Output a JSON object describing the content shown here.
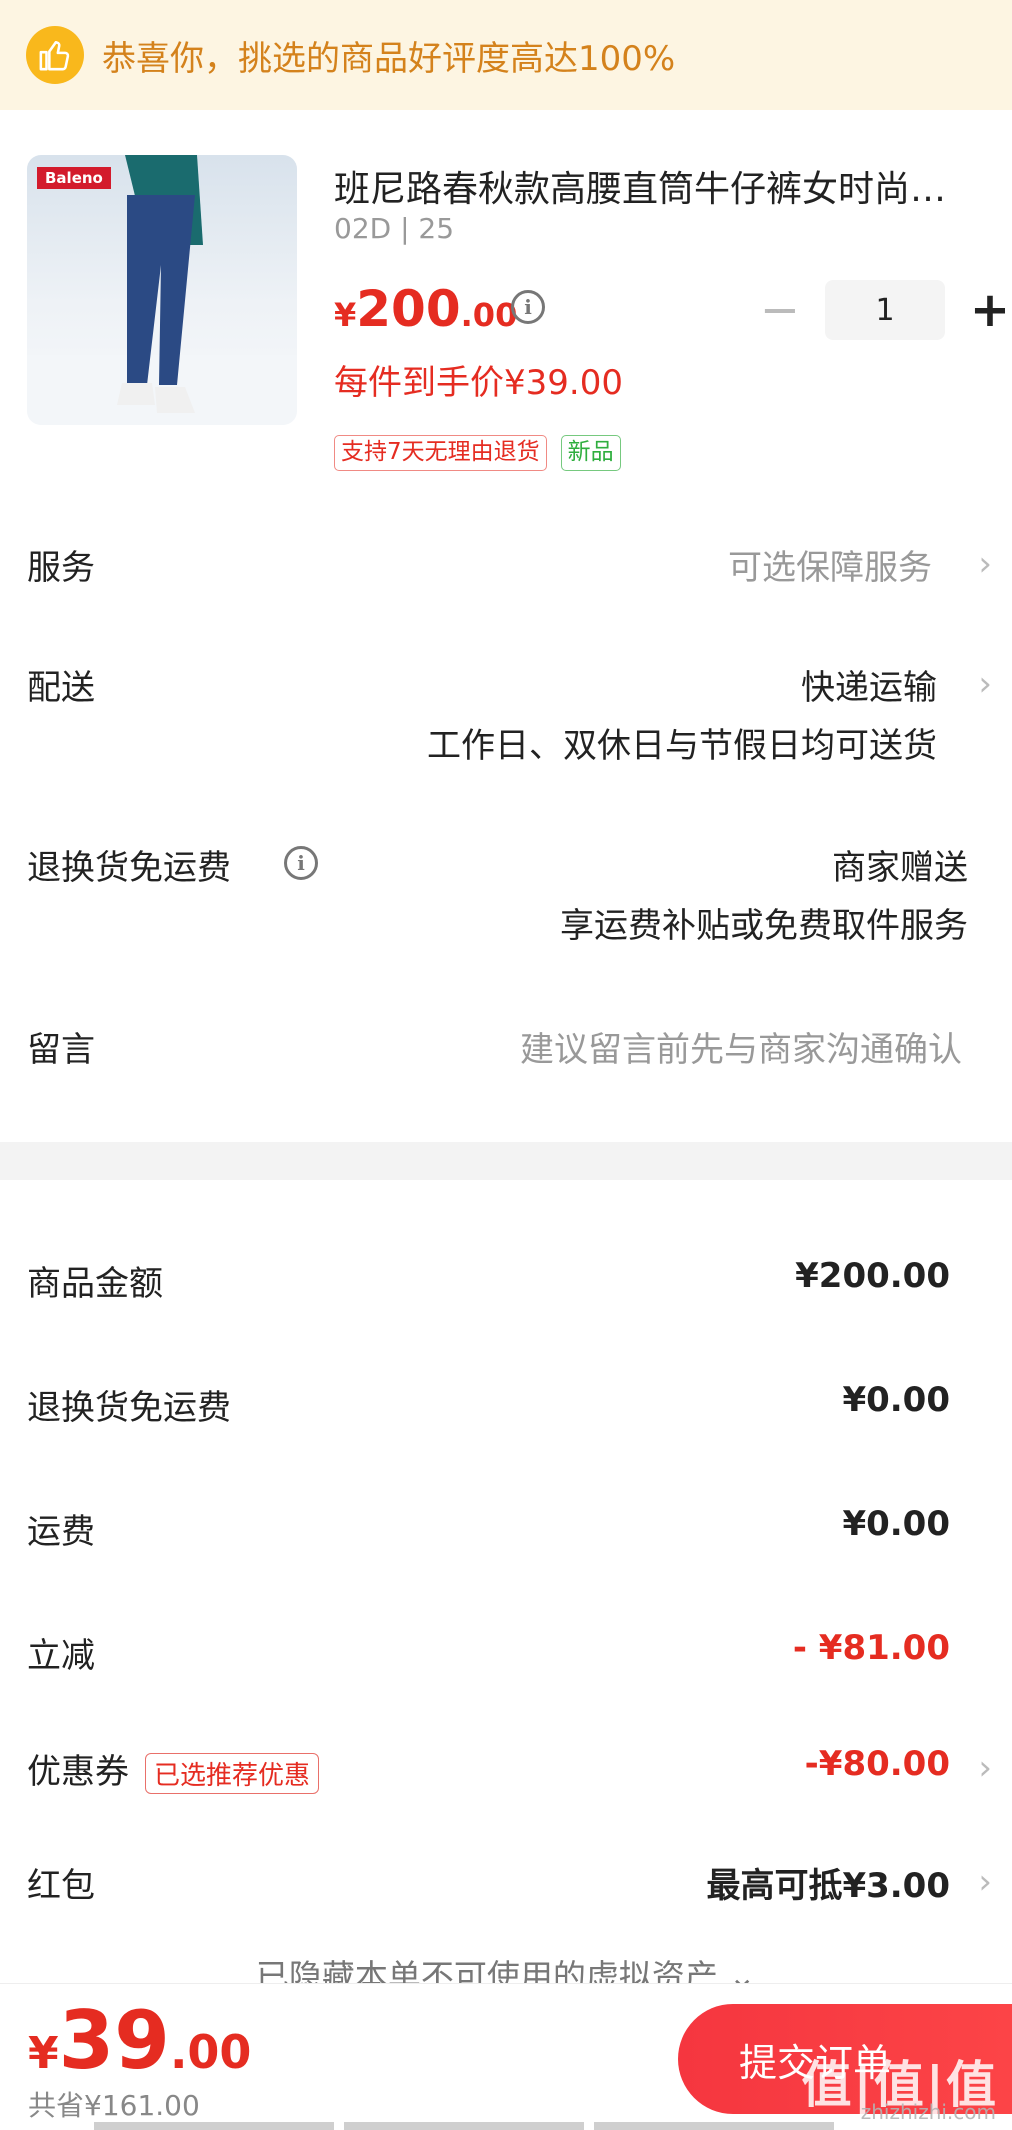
{
  "banner": {
    "text": "恭喜你，挑选的商品好评度高达100%",
    "icon": "thumbs-up-icon"
  },
  "product": {
    "brand_label": "Baleno",
    "title": "班尼路春秋款高腰直筒牛仔裤女时尚…",
    "sku": "02D | 25",
    "price_symbol": "¥",
    "price_int": "200",
    "price_dec": ".00",
    "final_price": "每件到手价¥39.00",
    "quantity": "1",
    "minus_label": "−",
    "plus_label": "+",
    "tags": [
      "支持7天无理由退货",
      "新品"
    ]
  },
  "rows": {
    "service": {
      "label": "服务",
      "value": "可选保障服务"
    },
    "delivery": {
      "label": "配送",
      "value": "快递运输",
      "sub": "工作日、双休日与节假日均可送货"
    },
    "return_freight": {
      "label": "退换货免运费",
      "value": "商家赠送",
      "sub": "享运费补贴或免费取件服务"
    },
    "message": {
      "label": "留言",
      "placeholder": "建议留言前先与商家沟通确认"
    }
  },
  "summary": {
    "goods_amount": {
      "label": "商品金额",
      "value": "¥200.00"
    },
    "return_freight": {
      "label": "退换货免运费",
      "value": "¥0.00"
    },
    "shipping": {
      "label": "运费",
      "value": "¥0.00"
    },
    "instant_discount": {
      "label": "立减",
      "value": "- ¥81.00"
    },
    "coupon": {
      "label": "优惠券",
      "tag": "已选推荐优惠",
      "value": "-¥80.00"
    },
    "red_packet": {
      "label": "红包",
      "value": "最高可抵¥3.00"
    },
    "hidden_assets": "已隐藏本单不可使用的虚拟资产 ⌄"
  },
  "bottom": {
    "total_symbol": "¥",
    "total_int": "39",
    "total_dec": ".00",
    "saved": "共省¥161.00",
    "submit_label": "提交订单"
  },
  "watermark": {
    "text": "值|值|值",
    "sub": "zhizhizhi.com"
  },
  "colors": {
    "accent_red": "#e52c21",
    "banner_bg": "#fdf5e2",
    "banner_text": "#d4821c"
  }
}
